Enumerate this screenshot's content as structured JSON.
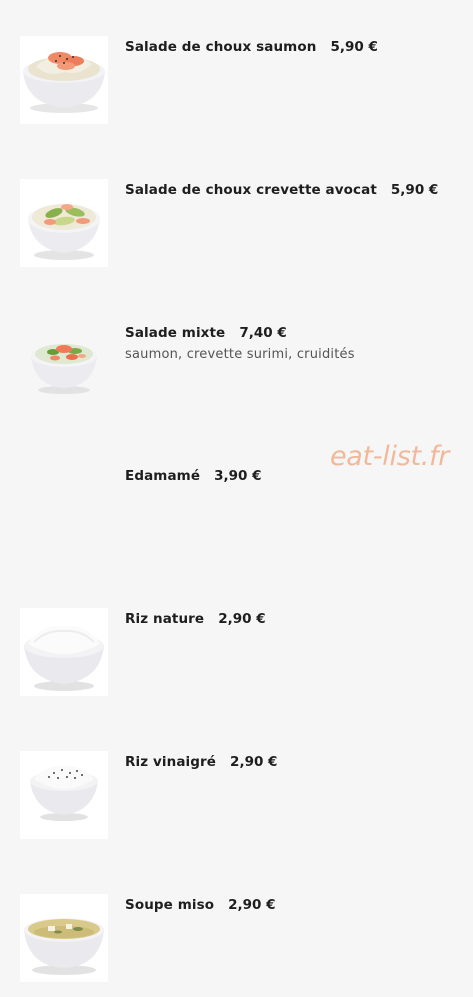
{
  "menu": {
    "items": [
      {
        "name": "Salade de choux saumon",
        "price": "5,90 €",
        "description": "",
        "image": "bowl-cabbage-salmon"
      },
      {
        "name": "Salade de choux crevette avocat",
        "price": "5,90 €",
        "description": "",
        "image": "bowl-cabbage-shrimp-avocado"
      },
      {
        "name": "Salade mixte",
        "price": "7,40 €",
        "description": "saumon, crevette surimi, cruidités",
        "image": "bowl-mixed-salad"
      },
      {
        "name": "Edamamé",
        "price": "3,90 €",
        "description": "",
        "image": ""
      },
      {
        "name": "Riz nature",
        "price": "2,90 €",
        "description": "",
        "image": "bowl-plain-rice"
      },
      {
        "name": "Riz vinaigré",
        "price": "2,90 €",
        "description": "",
        "image": "bowl-vinegar-rice"
      },
      {
        "name": "Soupe miso",
        "price": "2,90 €",
        "description": "",
        "image": "bowl-miso-soup"
      }
    ]
  },
  "watermark": "eat-list.fr"
}
